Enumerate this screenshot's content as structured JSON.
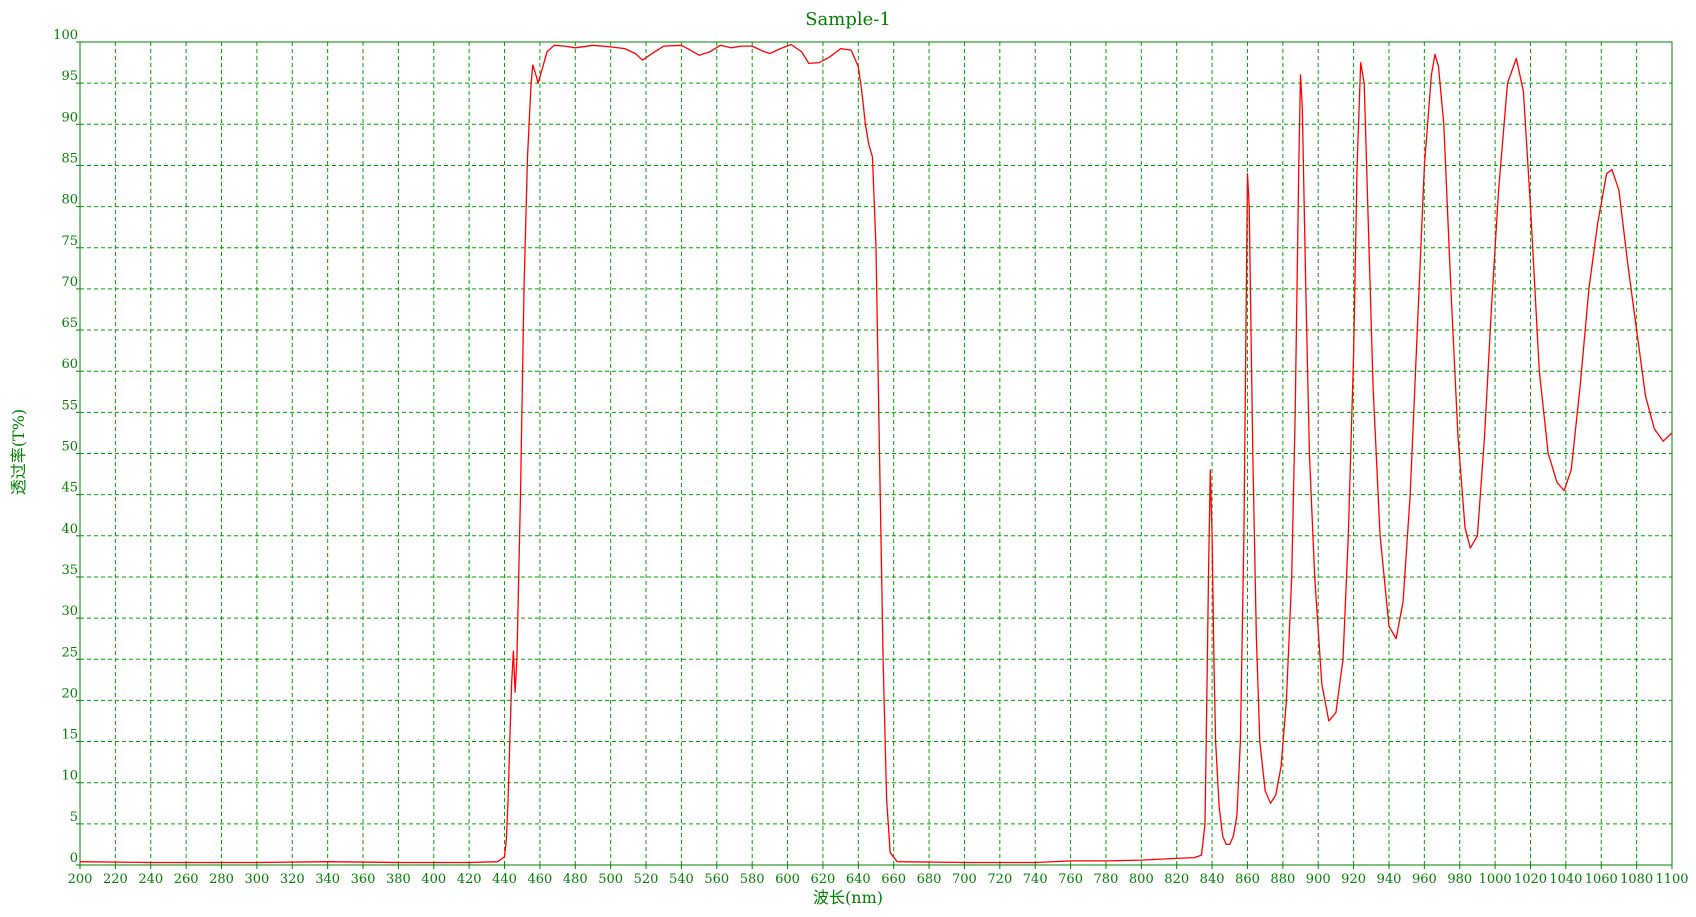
{
  "chart_data": {
    "type": "line",
    "title": "Sample-1",
    "xlabel": "波长(nm)",
    "ylabel": "透过率(T%)",
    "xlim": [
      200,
      1100
    ],
    "ylim": [
      0,
      100
    ],
    "x_ticks": [
      "200",
      "220",
      "240",
      "260",
      "280",
      "300",
      "320",
      "340",
      "360",
      "380",
      "400",
      "420",
      "440",
      "460",
      "480",
      "500",
      "520",
      "540",
      "560",
      "580",
      "600",
      "620",
      "640",
      "660",
      "680",
      "700",
      "720",
      "740",
      "760",
      "780",
      "800",
      "820",
      "840",
      "860",
      "880",
      "900",
      "920",
      "940",
      "960",
      "980",
      "1000",
      "1020",
      "1040",
      "1060",
      "1080",
      "1100"
    ],
    "y_ticks": [
      "0",
      "5",
      "10",
      "15",
      "20",
      "25",
      "30",
      "35",
      "40",
      "45",
      "50",
      "55",
      "60",
      "65",
      "70",
      "75",
      "80",
      "85",
      "90",
      "95",
      "100"
    ],
    "grid": true,
    "colors": {
      "text": "#008000",
      "grid": "#00a000",
      "line": "#ff0000",
      "axis": "#008000"
    },
    "series": [
      {
        "color": "#ff0000",
        "points": [
          [
            200,
            0.4
          ],
          [
            240,
            0.3
          ],
          [
            300,
            0.3
          ],
          [
            340,
            0.4
          ],
          [
            380,
            0.3
          ],
          [
            420,
            0.3
          ],
          [
            436,
            0.4
          ],
          [
            440,
            1.0
          ],
          [
            441,
            3
          ],
          [
            442,
            8
          ],
          [
            443,
            15
          ],
          [
            444,
            22
          ],
          [
            445,
            26
          ],
          [
            446,
            21
          ],
          [
            447,
            25
          ],
          [
            449,
            45
          ],
          [
            451,
            70
          ],
          [
            453,
            86
          ],
          [
            455,
            95
          ],
          [
            456,
            97.2
          ],
          [
            458,
            95.8
          ],
          [
            459,
            95.0
          ],
          [
            461,
            96.5
          ],
          [
            464,
            98.8
          ],
          [
            468,
            99.6
          ],
          [
            474,
            99.5
          ],
          [
            480,
            99.3
          ],
          [
            490,
            99.6
          ],
          [
            500,
            99.4
          ],
          [
            508,
            99.2
          ],
          [
            514,
            98.6
          ],
          [
            518,
            97.8
          ],
          [
            522,
            98.4
          ],
          [
            530,
            99.5
          ],
          [
            540,
            99.6
          ],
          [
            546,
            98.9
          ],
          [
            550,
            98.4
          ],
          [
            556,
            98.8
          ],
          [
            562,
            99.6
          ],
          [
            568,
            99.3
          ],
          [
            574,
            99.5
          ],
          [
            580,
            99.5
          ],
          [
            586,
            98.9
          ],
          [
            590,
            98.6
          ],
          [
            596,
            99.2
          ],
          [
            602,
            99.7
          ],
          [
            608,
            98.8
          ],
          [
            612,
            97.4
          ],
          [
            618,
            97.5
          ],
          [
            624,
            98.2
          ],
          [
            630,
            99.2
          ],
          [
            636,
            99.0
          ],
          [
            640,
            97.0
          ],
          [
            642,
            94.0
          ],
          [
            644,
            90.0
          ],
          [
            646,
            87.5
          ],
          [
            648,
            86.0
          ],
          [
            650,
            75
          ],
          [
            652,
            50
          ],
          [
            654,
            25
          ],
          [
            656,
            8
          ],
          [
            658,
            1.5
          ],
          [
            662,
            0.4
          ],
          [
            700,
            0.3
          ],
          [
            740,
            0.3
          ],
          [
            760,
            0.5
          ],
          [
            780,
            0.5
          ],
          [
            800,
            0.6
          ],
          [
            820,
            0.8
          ],
          [
            830,
            0.9
          ],
          [
            834,
            1.2
          ],
          [
            836,
            5
          ],
          [
            837,
            20
          ],
          [
            838,
            36
          ],
          [
            839,
            48
          ],
          [
            840,
            40
          ],
          [
            841,
            25
          ],
          [
            842,
            15
          ],
          [
            844,
            7
          ],
          [
            846,
            3.5
          ],
          [
            848,
            2.5
          ],
          [
            850,
            2.5
          ],
          [
            852,
            3.5
          ],
          [
            854,
            6
          ],
          [
            856,
            15
          ],
          [
            858,
            40
          ],
          [
            860,
            84
          ],
          [
            861,
            80
          ],
          [
            863,
            50
          ],
          [
            865,
            28
          ],
          [
            867,
            15
          ],
          [
            870,
            9
          ],
          [
            873,
            7.5
          ],
          [
            876,
            8.5
          ],
          [
            879,
            12
          ],
          [
            882,
            20
          ],
          [
            885,
            35
          ],
          [
            887,
            55
          ],
          [
            889,
            85
          ],
          [
            890,
            96
          ],
          [
            891,
            92
          ],
          [
            893,
            70
          ],
          [
            895,
            50
          ],
          [
            898,
            35
          ],
          [
            902,
            22
          ],
          [
            906,
            17.5
          ],
          [
            910,
            18.5
          ],
          [
            914,
            25
          ],
          [
            917,
            40
          ],
          [
            920,
            62
          ],
          [
            922,
            85
          ],
          [
            924,
            97.5
          ],
          [
            926,
            95
          ],
          [
            928,
            80
          ],
          [
            931,
            58
          ],
          [
            935,
            40
          ],
          [
            940,
            29
          ],
          [
            944,
            27.5
          ],
          [
            948,
            32
          ],
          [
            952,
            45
          ],
          [
            956,
            65
          ],
          [
            960,
            85
          ],
          [
            964,
            96
          ],
          [
            966,
            98.5
          ],
          [
            968,
            97
          ],
          [
            971,
            90
          ],
          [
            975,
            70
          ],
          [
            979,
            52
          ],
          [
            983,
            41
          ],
          [
            986,
            38.5
          ],
          [
            990,
            40
          ],
          [
            994,
            52
          ],
          [
            998,
            68
          ],
          [
            1002,
            82
          ],
          [
            1007,
            95
          ],
          [
            1012,
            98
          ],
          [
            1016,
            94
          ],
          [
            1020,
            80
          ],
          [
            1025,
            60
          ],
          [
            1030,
            50
          ],
          [
            1035,
            46.5
          ],
          [
            1039,
            45.5
          ],
          [
            1043,
            48
          ],
          [
            1048,
            58
          ],
          [
            1053,
            70
          ],
          [
            1058,
            78
          ],
          [
            1063,
            84
          ],
          [
            1066,
            84.5
          ],
          [
            1070,
            82
          ],
          [
            1075,
            73
          ],
          [
            1080,
            65
          ],
          [
            1085,
            57
          ],
          [
            1090,
            53
          ],
          [
            1095,
            51.5
          ],
          [
            1100,
            52.5
          ]
        ]
      }
    ]
  }
}
